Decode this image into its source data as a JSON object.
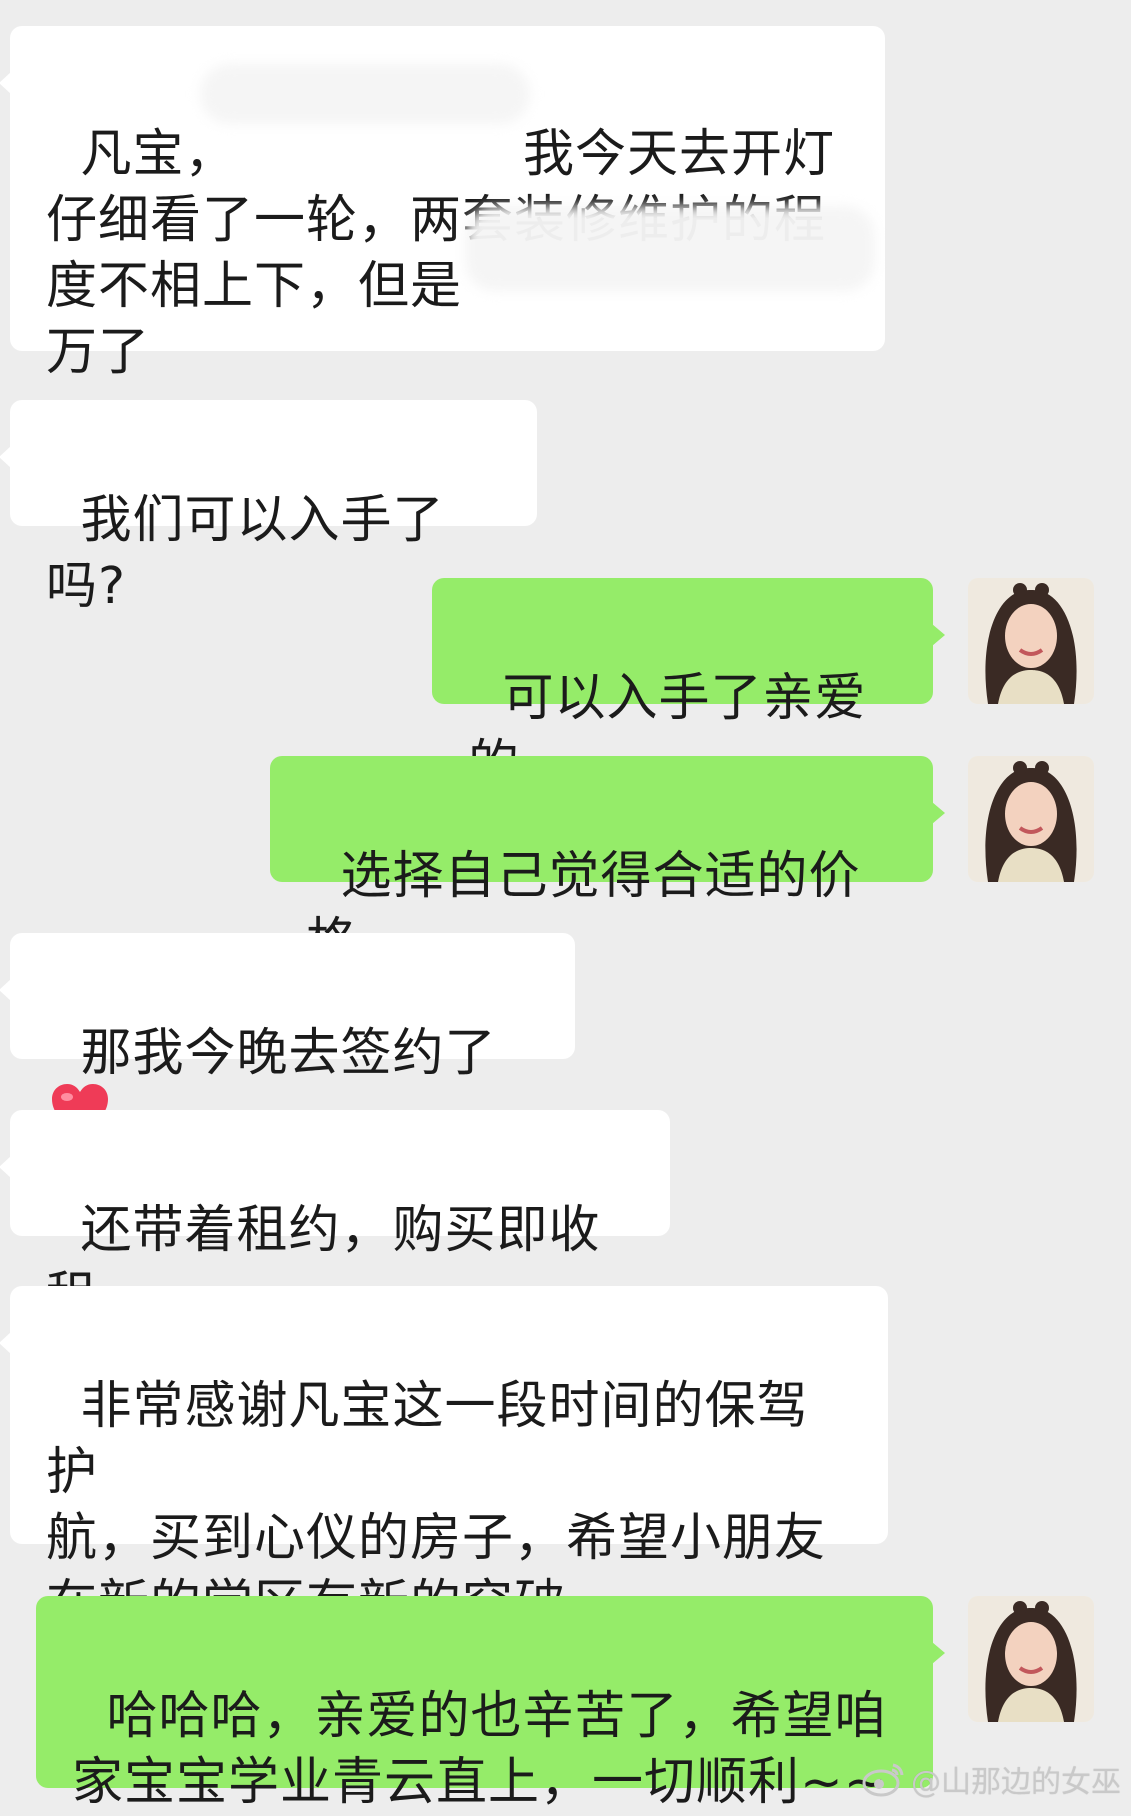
{
  "messages": [
    {
      "side": "in",
      "text": "凡宝，　　　　　　我今天去开灯\n仔细看了一轮，两套装修维护的程\n度不相上下，但是\n万了"
    },
    {
      "side": "in",
      "text": "我们可以入手了吗?"
    },
    {
      "side": "out",
      "text": "可以入手了亲爱的"
    },
    {
      "side": "out",
      "text": "选择自己觉得合适的价格"
    },
    {
      "side": "in",
      "text": "那我今晚去签约了"
    },
    {
      "side": "in",
      "text": "还带着租约，购买即收租"
    },
    {
      "side": "in",
      "text": "非常感谢凡宝这一段时间的保驾护\n航，买到心仪的房子，希望小朋友\n在新的学区有新的突破"
    },
    {
      "side": "out",
      "text": "哈哈哈，亲爱的也辛苦了，希望咱\n家宝宝学业青云直上，一切顺利~~"
    }
  ],
  "icons": {
    "heart": "heart-emoji",
    "avatar": "user-avatar-photo",
    "watermark_logo": "weibo-logo"
  },
  "watermark": {
    "text": "@山那边的女巫"
  },
  "colors": {
    "background": "#ededed",
    "incoming_bubble": "#ffffff",
    "outgoing_bubble": "#95ec69",
    "heart": "#ef3b57"
  }
}
